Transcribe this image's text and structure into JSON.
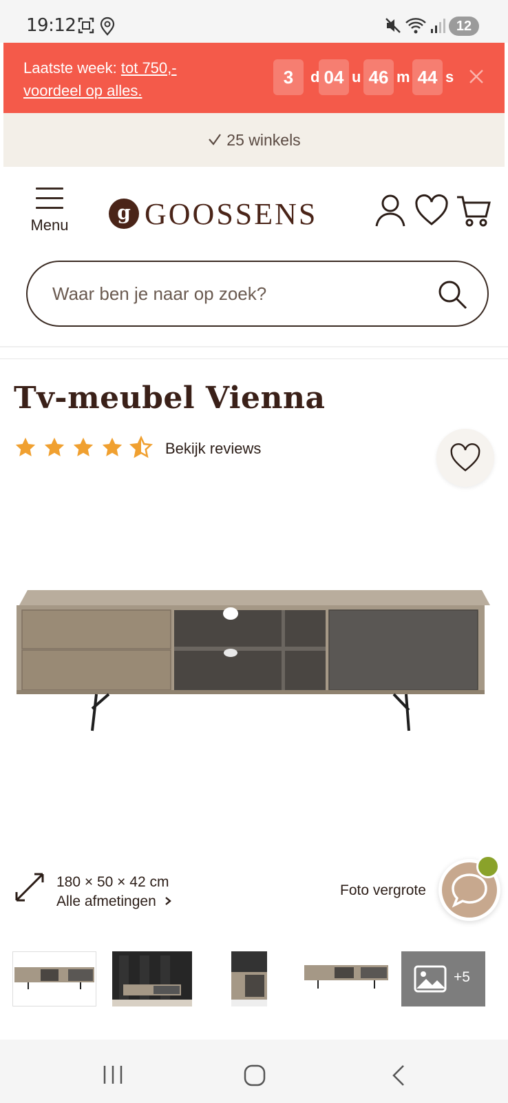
{
  "status_bar": {
    "time": "19:12",
    "notification_count": "12",
    "icons": [
      "screenshot-icon",
      "location-icon",
      "mute-icon",
      "wifi-icon",
      "signal-icon"
    ]
  },
  "promo": {
    "prefix": "Laatste week: ",
    "link_part1": "tot 750,-",
    "link_part2": "voordeel op alles.",
    "countdown": [
      {
        "value": "3",
        "unit": "d"
      },
      {
        "value": "04",
        "unit": "u"
      },
      {
        "value": "46",
        "unit": "m"
      },
      {
        "value": "44",
        "unit": "s"
      }
    ],
    "background_color": "#f45a4a"
  },
  "stores": {
    "label": "25 winkels"
  },
  "header": {
    "menu_label": "Menu",
    "logo_mark": "g",
    "logo_text": "GOOSSENS",
    "brand_color": "#4a2418"
  },
  "search": {
    "placeholder": "Waar ben je naar op zoek?"
  },
  "product": {
    "title": "Tv-meubel Vienna",
    "rating": 4.5,
    "rating_max": 5,
    "reviews_link": "Bekijk reviews",
    "star_color": "#f0a030",
    "dimensions": "180 × 50 × 42 cm",
    "all_dimensions": "Alle afmetingen",
    "zoom_label": "Foto vergrote",
    "more_photos": "+5"
  }
}
